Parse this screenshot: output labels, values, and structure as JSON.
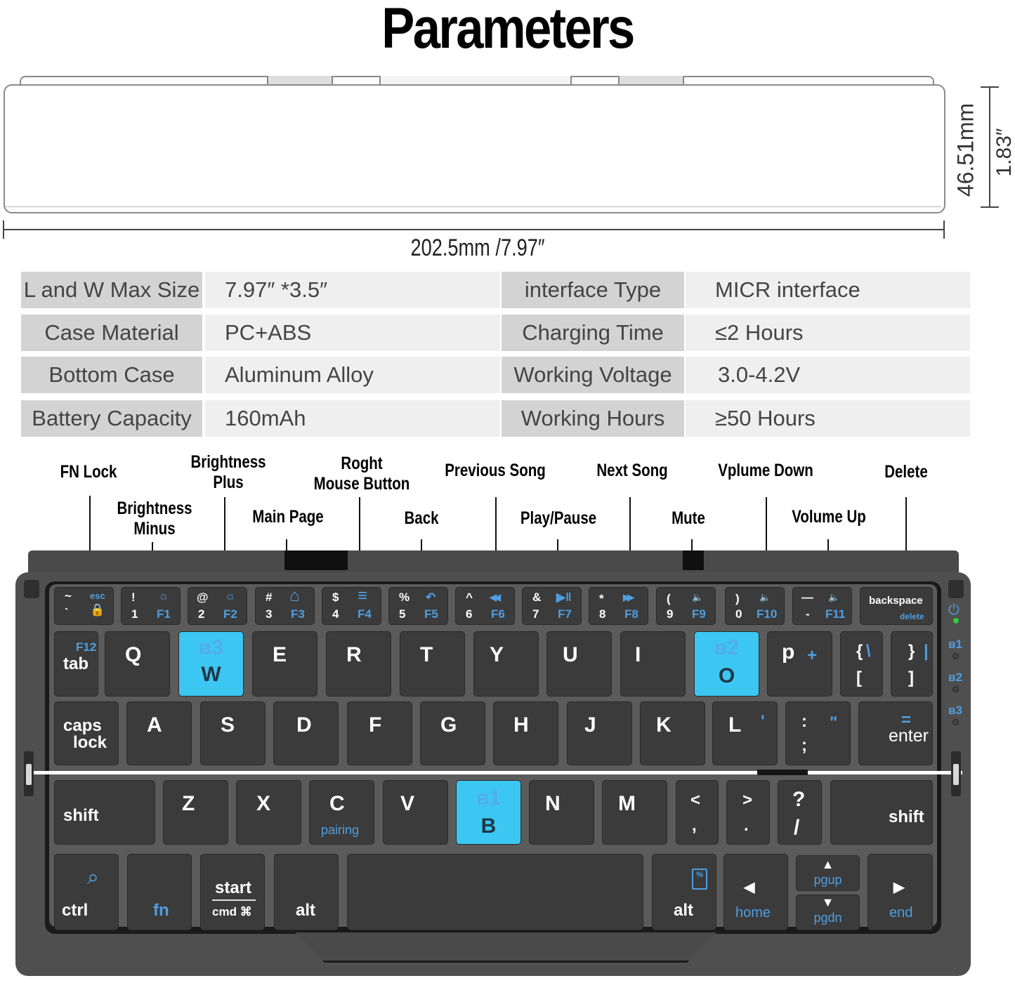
{
  "title": "Parameters",
  "dimensions": {
    "width": "202.5mm /7.97″",
    "height_mm": "46.51mm",
    "height_in": "1.83″"
  },
  "specs": [
    {
      "label": "L and W Max Size",
      "value": "7.97″  *3.5″"
    },
    {
      "label": "Case Material",
      "value": "PC+ABS"
    },
    {
      "label": "Bottom Case",
      "value": "Aluminum Alloy"
    },
    {
      "label": "Battery Capacity",
      "value": "160mAh"
    },
    {
      "label": "interface Type",
      "value": "MICR interface"
    },
    {
      "label": "Charging Time",
      "value": "≤2 Hours"
    },
    {
      "label": "Working Voltage",
      "value": "3.0-4.2V"
    },
    {
      "label": "Working Hours",
      "value": "≥50 Hours"
    }
  ],
  "callouts": [
    {
      "line1": "FN Lock",
      "line2": ""
    },
    {
      "line1": "Brightness",
      "line2": "Minus"
    },
    {
      "line1": "Brightness",
      "line2": "Plus"
    },
    {
      "line1": "Main Page",
      "line2": ""
    },
    {
      "line1": "Roght",
      "line2": "Mouse Button"
    },
    {
      "line1": "Back",
      "line2": ""
    },
    {
      "line1": "Previous Song",
      "line2": ""
    },
    {
      "line1": "Play/Pause",
      "line2": ""
    },
    {
      "line1": "Next Song",
      "line2": ""
    },
    {
      "line1": "Mute",
      "line2": ""
    },
    {
      "line1": "Vplume Down",
      "line2": ""
    },
    {
      "line1": "Volume Up",
      "line2": ""
    },
    {
      "line1": "Delete",
      "line2": ""
    }
  ],
  "keyboard": {
    "colors": {
      "accent": "#4f9ee0",
      "highlight": "#3cc7f2",
      "key": "#3b3b3b",
      "deck": "#5b5b5b"
    },
    "fn_row": [
      {
        "top": "~",
        "bottom": "`",
        "fn": "esc",
        "icon": "lock-icon"
      },
      {
        "top": "!",
        "bottom": "1",
        "fn": "F1",
        "icon": "brightness-down-icon"
      },
      {
        "top": "@",
        "bottom": "2",
        "fn": "F2",
        "icon": "brightness-up-icon"
      },
      {
        "top": "#",
        "bottom": "3",
        "fn": "F3",
        "icon": "home-icon"
      },
      {
        "top": "$",
        "bottom": "4",
        "fn": "F4",
        "icon": "menu-icon"
      },
      {
        "top": "%",
        "bottom": "5",
        "fn": "F5",
        "icon": "back-icon"
      },
      {
        "top": "^",
        "bottom": "6",
        "fn": "F6",
        "icon": "rewind-icon"
      },
      {
        "top": "&",
        "bottom": "7",
        "fn": "F7",
        "icon": "play-pause-icon"
      },
      {
        "top": "*",
        "bottom": "8",
        "fn": "F8",
        "icon": "fast-forward-icon"
      },
      {
        "top": "(",
        "bottom": "9",
        "fn": "F9",
        "icon": "mute-icon"
      },
      {
        "top": ")",
        "bottom": "0",
        "fn": "F10",
        "icon": "volume-down-icon"
      },
      {
        "top": "—",
        "bottom": "-",
        "fn": "F11",
        "icon": "volume-up-icon"
      }
    ],
    "glyphs": {
      "lock": "🔒",
      "sun": "☼",
      "home": "⌂",
      "menu": "≡",
      "back": "↶",
      "rewind": "◀◀",
      "playpause": "▶‖",
      "ff": "▶▶",
      "speaker": "🔈",
      "bt": "ʙ"
    },
    "backspace": {
      "label": "backspace",
      "fn": "delete"
    },
    "tab": {
      "label": "tab",
      "fn": "F12"
    },
    "row_q": [
      "Q",
      "W",
      "E",
      "R",
      "T",
      "Y",
      "U",
      "I",
      "O",
      "p"
    ],
    "bt_w": "3",
    "bt_o": "2",
    "bt_b": "1",
    "p_fn": "+",
    "bracket_l": {
      "top": "{",
      "bottom": "[",
      "fn": "\\"
    },
    "bracket_r": {
      "top": "}",
      "bottom": "]",
      "fn": "|"
    },
    "caps": {
      "line1": "caps",
      "line2": "lock"
    },
    "row_a": [
      "A",
      "S",
      "D",
      "F",
      "G",
      "H",
      "J",
      "K",
      "L"
    ],
    "l_fn": "'",
    "semicolon": {
      "top": ":",
      "bottom": ";",
      "fn": "\""
    },
    "enter": {
      "label": "enter",
      "fn": "="
    },
    "shift_l": "shift",
    "row_z": [
      "Z",
      "X",
      "C",
      "V",
      "B",
      "N",
      "M"
    ],
    "c_fn": "pairing",
    "comma": {
      "top": "<",
      "bottom": ","
    },
    "period": {
      "top": ">",
      "bottom": "."
    },
    "slash": {
      "top": "?",
      "bottom": "/"
    },
    "shift_r": "shift",
    "ctrl": "ctrl",
    "fn": "fn",
    "start": {
      "top": "start",
      "bottom": "cmd ⌘"
    },
    "alt_l": "alt",
    "alt_r": "alt",
    "home": "home",
    "pgup": "pgup",
    "pgdn": "pgdn",
    "end": "end",
    "arrow_left": "◀",
    "arrow_right": "▶",
    "arrow_up": "▲",
    "arrow_down": "▼",
    "search_glyph": "⌕",
    "battery_glyph": "%",
    "power_glyph": "⏻",
    "indicators": [
      "1",
      "2",
      "3"
    ]
  }
}
